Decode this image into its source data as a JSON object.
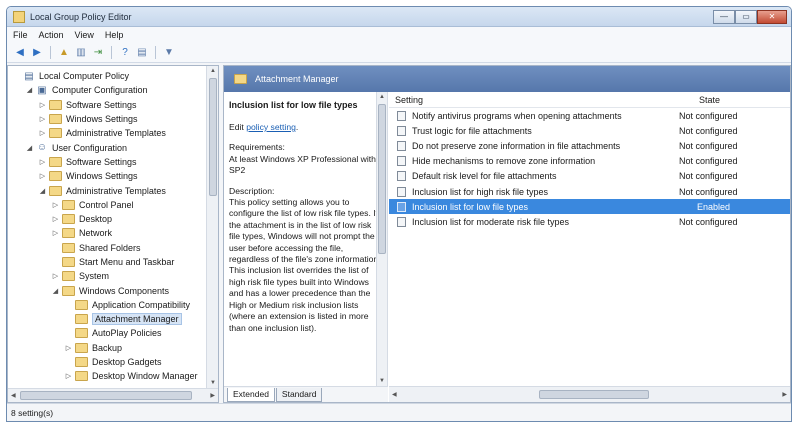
{
  "window": {
    "title": "Local Group Policy Editor",
    "minimize": "—",
    "maximize": "▭",
    "close": "✕"
  },
  "menu": [
    "File",
    "Action",
    "View",
    "Help"
  ],
  "tree": [
    {
      "label": "Local Computer Policy",
      "depth": 0,
      "expander": "",
      "icon": "policy-icon"
    },
    {
      "label": "Computer Configuration",
      "depth": 1,
      "expander": "◢",
      "icon": "computer-icon"
    },
    {
      "label": "Software Settings",
      "depth": 2,
      "expander": "▷",
      "icon": "folder-icon"
    },
    {
      "label": "Windows Settings",
      "depth": 2,
      "expander": "▷",
      "icon": "folder-icon"
    },
    {
      "label": "Administrative Templates",
      "depth": 2,
      "expander": "▷",
      "icon": "folder-icon"
    },
    {
      "label": "User Configuration",
      "depth": 1,
      "expander": "◢",
      "icon": "user-icon"
    },
    {
      "label": "Software Settings",
      "depth": 2,
      "expander": "▷",
      "icon": "folder-icon"
    },
    {
      "label": "Windows Settings",
      "depth": 2,
      "expander": "▷",
      "icon": "folder-icon"
    },
    {
      "label": "Administrative Templates",
      "depth": 2,
      "expander": "◢",
      "icon": "folder-icon"
    },
    {
      "label": "Control Panel",
      "depth": 3,
      "expander": "▷",
      "icon": "folder-icon"
    },
    {
      "label": "Desktop",
      "depth": 3,
      "expander": "▷",
      "icon": "folder-icon"
    },
    {
      "label": "Network",
      "depth": 3,
      "expander": "▷",
      "icon": "folder-icon"
    },
    {
      "label": "Shared Folders",
      "depth": 3,
      "expander": "",
      "icon": "folder-icon"
    },
    {
      "label": "Start Menu and Taskbar",
      "depth": 3,
      "expander": "",
      "icon": "folder-icon"
    },
    {
      "label": "System",
      "depth": 3,
      "expander": "▷",
      "icon": "folder-icon"
    },
    {
      "label": "Windows Components",
      "depth": 3,
      "expander": "◢",
      "icon": "folder-icon"
    },
    {
      "label": "Application Compatibility",
      "depth": 4,
      "expander": "",
      "icon": "folder-icon"
    },
    {
      "label": "Attachment Manager",
      "depth": 4,
      "expander": "",
      "icon": "folder-icon",
      "selected": true
    },
    {
      "label": "AutoPlay Policies",
      "depth": 4,
      "expander": "",
      "icon": "folder-icon"
    },
    {
      "label": "Backup",
      "depth": 4,
      "expander": "▷",
      "icon": "folder-icon"
    },
    {
      "label": "Desktop Gadgets",
      "depth": 4,
      "expander": "",
      "icon": "folder-icon"
    },
    {
      "label": "Desktop Window Manager",
      "depth": 4,
      "expander": "▷",
      "icon": "folder-icon"
    }
  ],
  "header": {
    "title": "Attachment Manager"
  },
  "description": {
    "title": "Inclusion list for low file types",
    "edit_prefix": "Edit ",
    "edit_link": "policy setting",
    "edit_suffix": ".",
    "requirements": "Requirements:\nAt least Windows XP Professional with SP2",
    "description_label": "Description:",
    "description_text": "This policy setting allows you to configure the list of low risk file types. If the attachment is in the list of low risk file types, Windows will not prompt the user before accessing the file, regardless of the file's zone information. This inclusion list overrides the list of high risk file types built into Windows and has a lower precedence than the High or Medium risk inclusion lists (where an extension is listed in more than one inclusion list)."
  },
  "list": {
    "columns": {
      "setting": "Setting",
      "state": "State"
    },
    "rows": [
      {
        "setting": "Notify antivirus programs when opening attachments",
        "state": "Not configured"
      },
      {
        "setting": "Trust logic for file attachments",
        "state": "Not configured"
      },
      {
        "setting": "Do not preserve zone information in file attachments",
        "state": "Not configured"
      },
      {
        "setting": "Hide mechanisms to remove zone information",
        "state": "Not configured"
      },
      {
        "setting": "Default risk level for file attachments",
        "state": "Not configured"
      },
      {
        "setting": "Inclusion list for high risk file types",
        "state": "Not configured"
      },
      {
        "setting": "Inclusion list for low file types",
        "state": "Enabled",
        "selected": true
      },
      {
        "setting": "Inclusion list for moderate risk file types",
        "state": "Not configured"
      }
    ]
  },
  "tabs": [
    "Extended",
    "Standard"
  ],
  "status": "8 setting(s)",
  "colors": {
    "selection": "#3a88de",
    "header_band": "#5f80b5"
  }
}
